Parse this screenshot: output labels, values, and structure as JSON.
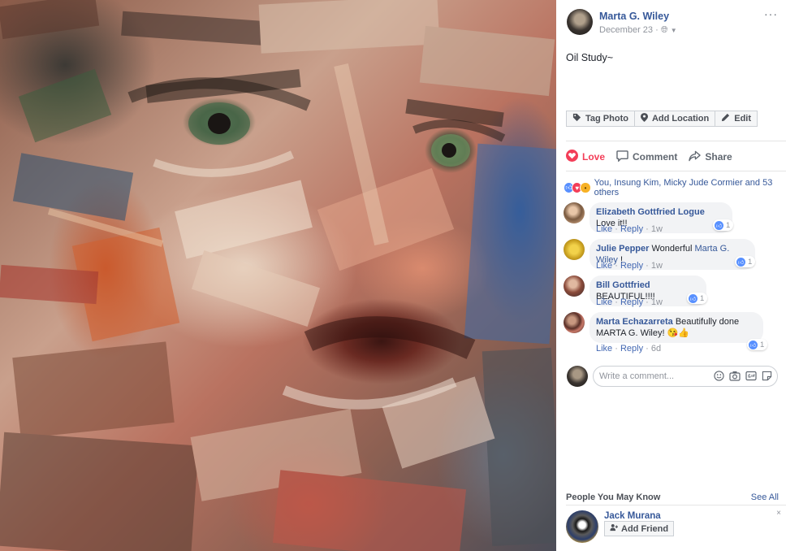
{
  "post": {
    "author": "Marta G. Wiley",
    "date": "December 23",
    "meta_sep": "·",
    "privacy_icon": "globe-icon",
    "more_label": "···",
    "caption": "Oil Study~"
  },
  "photo_actions": [
    {
      "label": "Tag Photo",
      "icon": "tag-icon"
    },
    {
      "label": "Add Location",
      "icon": "location-pin-icon"
    },
    {
      "label": "Edit",
      "icon": "pencil-icon"
    }
  ],
  "post_actions": {
    "love": "Love",
    "comment": "Comment",
    "share": "Share"
  },
  "reactions_summary": "You, Insung Kim, Micky Jude Cormier and 53 others",
  "comments": [
    {
      "name": "Elizabeth Gottfried Logue",
      "text": "Love it!!",
      "like": "Like",
      "reply": "Reply",
      "time": "1w",
      "reaction_count": "1"
    },
    {
      "name": "Julie Pepper",
      "text": "Wonderful",
      "mention": "Marta G. Wiley",
      "text_after": "!",
      "like": "Like",
      "reply": "Reply",
      "time": "1w",
      "reaction_count": "1"
    },
    {
      "name": "Bill Gottfried",
      "text": "BEAUTIFUL!!!!",
      "like": "Like",
      "reply": "Reply",
      "time": "1w",
      "reaction_count": "1"
    },
    {
      "name": "Marta Echazarreta",
      "text": "Beautifully done",
      "text_line2": "MARTA G. Wiley!",
      "emoji": "😘👍",
      "like": "Like",
      "reply": "Reply",
      "time": "6d",
      "reaction_count": "1"
    }
  ],
  "comment_sep": "·",
  "write_comment": {
    "placeholder": "Write a comment..."
  },
  "pymk": {
    "heading": "People You May Know",
    "see_all": "See All",
    "person_name": "Jack Murana",
    "add_friend": "Add Friend",
    "close": "×"
  },
  "colors": {
    "link": "#365899",
    "love": "#f33e58",
    "like_blue": "#5890ff",
    "muted": "#90949c"
  }
}
